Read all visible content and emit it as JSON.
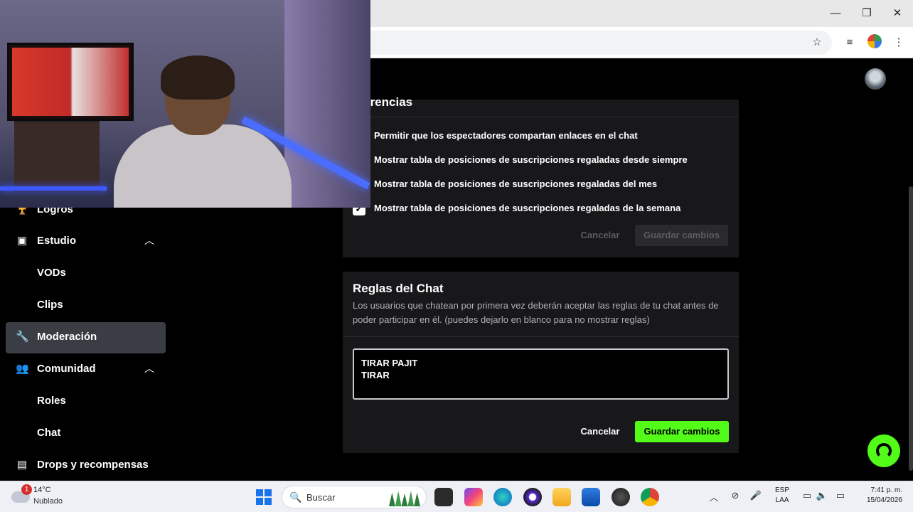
{
  "browser": {
    "window_controls": {
      "minimize": "—",
      "maximize": "❐",
      "close": "✕"
    },
    "toolbar_icons": [
      "star-icon",
      "media-icon",
      "profile-icon",
      "menu-icon"
    ]
  },
  "sidebar": {
    "items": [
      {
        "label": "Logros",
        "icon": "trophy-icon"
      },
      {
        "label": "Estudio",
        "icon": "studio-icon",
        "expanded": true
      },
      {
        "label": "VODs"
      },
      {
        "label": "Clips"
      },
      {
        "label": "Moderación",
        "icon": "wrench-icon",
        "active": true
      },
      {
        "label": "Comunidad",
        "icon": "community-icon",
        "expanded": true
      },
      {
        "label": "Roles"
      },
      {
        "label": "Chat"
      },
      {
        "label": "Drops y recompensas",
        "icon": "drops-icon"
      }
    ]
  },
  "preferences": {
    "title": "eferencias",
    "options": [
      {
        "label": "Permitir que los espectadores compartan enlaces en el chat",
        "checked": true
      },
      {
        "label": "Mostrar tabla de posiciones de suscripciones regaladas desde siempre",
        "checked": true
      },
      {
        "label": "Mostrar tabla de posiciones de suscripciones regaladas del mes",
        "checked": true
      },
      {
        "label": "Mostrar tabla de posiciones de suscripciones regaladas de la semana",
        "checked": true
      }
    ],
    "cancel_label": "Cancelar",
    "save_label": "Guardar cambios"
  },
  "chat_rules": {
    "title": "Reglas del Chat",
    "description": "Los usuarios que chatean por primera vez deberán aceptar las reglas de tu chat antes de poder participar en él. (puedes dejarlo en blanco para no mostrar reglas)",
    "value": "TIRAR PAJIT\nTIRAR",
    "cancel_label": "Cancelar",
    "save_label": "Guardar cambios"
  },
  "colors": {
    "accent": "#53fc18",
    "panel": "#18181b",
    "active_item": "#3a3d44"
  },
  "taskbar": {
    "weather_temp": "14°C",
    "weather_condition": "Nublado",
    "notification_count": "1",
    "search_placeholder": "Buscar",
    "language_line1": "ESP",
    "language_line2": "LAA",
    "time": "7:41 p. m.",
    "date": "15/04/2026"
  }
}
